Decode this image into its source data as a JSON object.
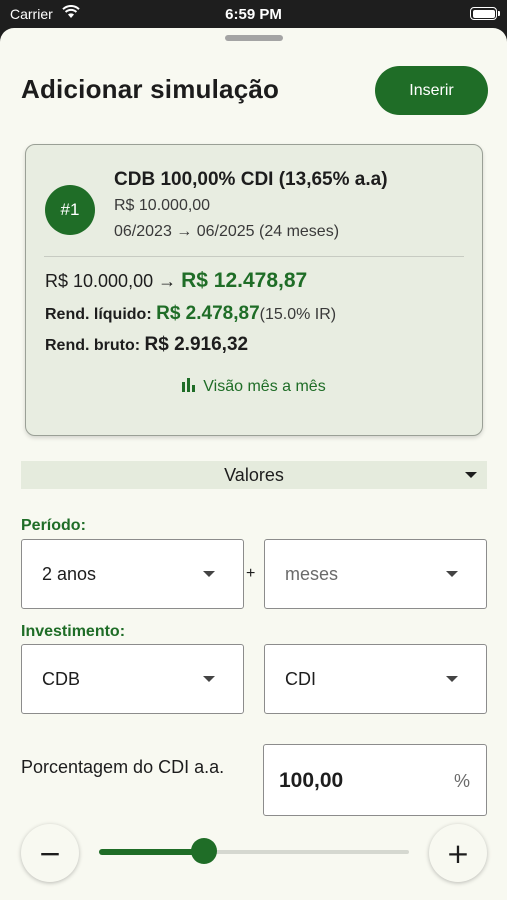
{
  "status_bar": {
    "carrier": "Carrier",
    "time": "6:59 PM"
  },
  "header": {
    "title": "Adicionar simulação",
    "insert_label": "Inserir"
  },
  "card": {
    "badge": "#1",
    "name": "CDB 100,00% CDI (13,65% a.a)",
    "amount": "R$ 10.000,00",
    "period": "06/2023 → 06/2025 (24 meses)",
    "initial": "R$ 10.000,00 →",
    "final": "R$ 12.478,87",
    "net_label": "Rend. líquido:",
    "net_value": "R$ 2.478,87",
    "net_ir": "(15.0% IR)",
    "gross_label": "Rend. bruto:",
    "gross_value": "R$ 2.916,32",
    "monthly_link": "Visão mês a mês"
  },
  "values_section": {
    "label": "Valores"
  },
  "period": {
    "label": "Período:",
    "years": "2 anos",
    "months_placeholder": "meses",
    "plus": "+"
  },
  "investment": {
    "label": "Investimento:",
    "type": "CDB",
    "index": "CDI"
  },
  "cdi_pct": {
    "label": "Porcentagem do CDI a.a.",
    "value": "100,00",
    "unit": "%",
    "minus_label": "−",
    "plus_label": "+",
    "slider_fraction": 0.34
  },
  "colors": {
    "accent": "#1f6d27",
    "background": "#f8f9f1",
    "card": "#e8ede1"
  }
}
